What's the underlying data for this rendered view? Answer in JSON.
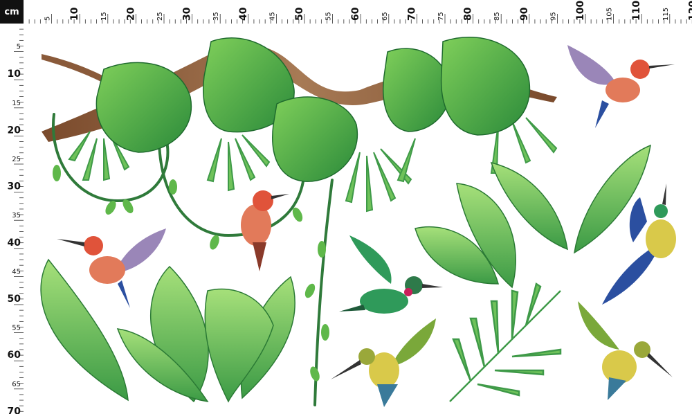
{
  "ruler": {
    "unit": "cm",
    "top_labels": [
      {
        "value": "5",
        "major": false
      },
      {
        "value": "10",
        "major": true
      },
      {
        "value": "15",
        "major": false
      },
      {
        "value": "20",
        "major": true
      },
      {
        "value": "25",
        "major": false
      },
      {
        "value": "30",
        "major": true
      },
      {
        "value": "35",
        "major": false
      },
      {
        "value": "40",
        "major": true
      },
      {
        "value": "45",
        "major": false
      },
      {
        "value": "50",
        "major": true
      },
      {
        "value": "55",
        "major": false
      },
      {
        "value": "60",
        "major": true
      },
      {
        "value": "65",
        "major": false
      },
      {
        "value": "70",
        "major": true
      },
      {
        "value": "75",
        "major": false
      },
      {
        "value": "80",
        "major": true
      },
      {
        "value": "85",
        "major": false
      },
      {
        "value": "90",
        "major": true
      },
      {
        "value": "95",
        "major": false
      },
      {
        "value": "100",
        "major": true
      },
      {
        "value": "105",
        "major": false
      },
      {
        "value": "110",
        "major": true
      },
      {
        "value": "115",
        "major": false
      },
      {
        "value": "120",
        "major": true
      }
    ],
    "left_labels": [
      {
        "value": "5",
        "major": false
      },
      {
        "value": "10",
        "major": true
      },
      {
        "value": "15",
        "major": false
      },
      {
        "value": "20",
        "major": true
      },
      {
        "value": "25",
        "major": false
      },
      {
        "value": "30",
        "major": true
      },
      {
        "value": "35",
        "major": false
      },
      {
        "value": "40",
        "major": true
      },
      {
        "value": "45",
        "major": false
      },
      {
        "value": "50",
        "major": true
      },
      {
        "value": "55",
        "major": false
      },
      {
        "value": "60",
        "major": true
      },
      {
        "value": "65",
        "major": false
      },
      {
        "value": "70",
        "major": true
      }
    ]
  },
  "colors": {
    "leaf_dark": "#2e8b3a",
    "leaf_mid": "#4caf50",
    "leaf_light": "#8bd36b",
    "vine": "#2f7a3a",
    "branch": "#8a5a3a",
    "bird_red": "#e0533a",
    "bird_green": "#2f9a5a",
    "bird_yellow": "#d9c94a",
    "bird_blue": "#2b4fa0",
    "wing_lilac": "#9a86b8"
  }
}
